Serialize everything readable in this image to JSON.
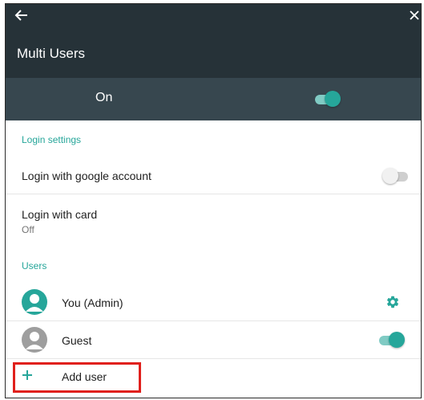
{
  "app": {
    "title": "Multi Users",
    "back_icon": "arrow-back-icon",
    "close_icon": "close-icon"
  },
  "master": {
    "label": "On",
    "toggle_on": true
  },
  "login_settings": {
    "header": "Login settings",
    "google": {
      "title": "Login with google account",
      "toggle_on": false
    },
    "card": {
      "title": "Login with card",
      "summary": "Off"
    }
  },
  "users": {
    "header": "Users",
    "items": [
      {
        "name": "You (Admin)",
        "avatar": "person-icon",
        "avatar_color": "#26a69a",
        "action": "settings-gear-icon"
      },
      {
        "name": "Guest",
        "avatar": "person-icon",
        "avatar_color": "#9e9e9e",
        "toggle_on": true
      }
    ],
    "add_label": "Add user"
  },
  "colors": {
    "accent": "#26a69a",
    "appbar": "#263238",
    "master_bar": "#37474f",
    "highlight": "#e0201c"
  }
}
